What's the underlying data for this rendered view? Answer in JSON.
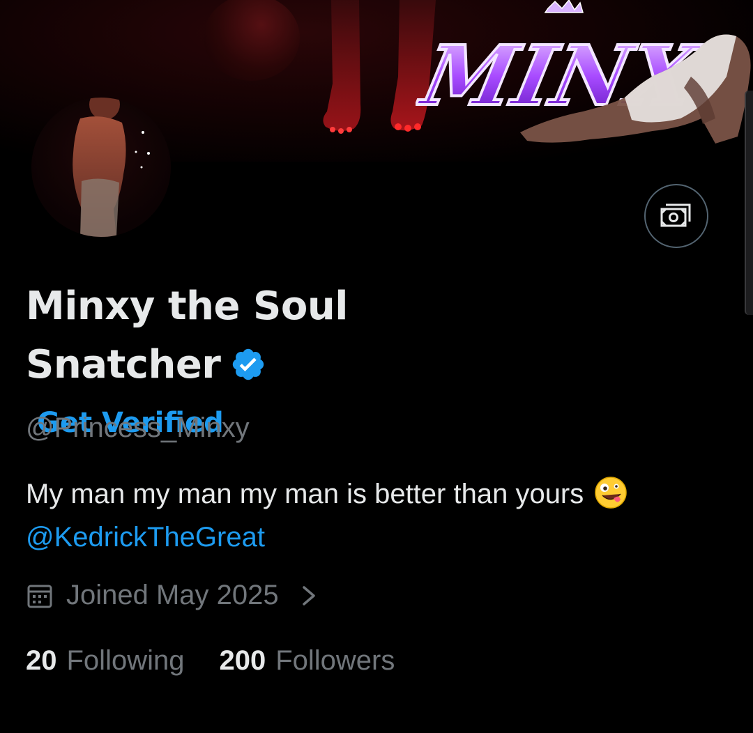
{
  "banner": {
    "logo_text": "MINX"
  },
  "profile": {
    "display_name": "Minxy the Soul Snatcher",
    "get_verified_label": "Get Verified",
    "handle": "@Princess_Minxy",
    "bio_text": "My man my man my man is better than yours",
    "bio_emoji": "zany-face-emoji",
    "bio_mention": "@KedrickTheGreat",
    "joined": "Joined May 2025"
  },
  "stats": {
    "following_count": "20",
    "following_label": "Following",
    "followers_count": "200",
    "followers_label": "Followers"
  },
  "icons": {
    "tip": "money-icon",
    "verified": "verified-badge-icon",
    "calendar": "calendar-icon",
    "chevron": "chevron-right-icon"
  },
  "colors": {
    "background": "#000000",
    "primary_text": "#e7e9ea",
    "secondary_text": "#71767b",
    "accent": "#1d9bf0",
    "logo_purple": "#9b3dff"
  }
}
